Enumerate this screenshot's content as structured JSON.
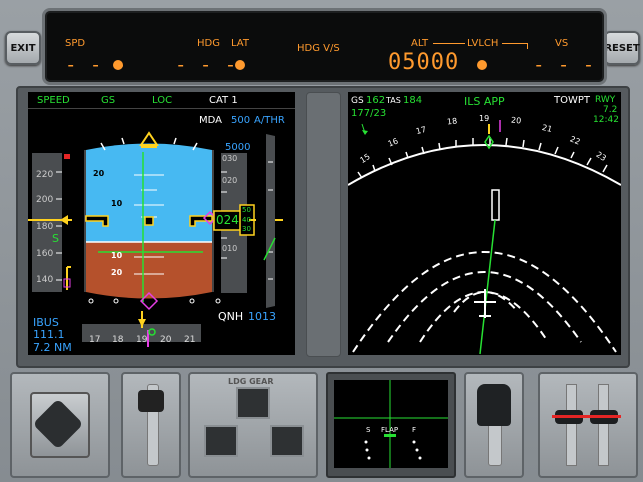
{
  "buttons": {
    "exit": "EXIT",
    "reset": "RESET"
  },
  "fcu": {
    "spd_label": "SPD",
    "spd_value": "- - -",
    "hdg_label": "HDG",
    "lat_label": "LAT",
    "hdg_value": "- - -",
    "mode_label": "HDG V/S",
    "alt_label": "ALT",
    "lvlch_label": "LVLCH",
    "alt_value": "05000",
    "vs_label": "VS",
    "vs_value": "- - -"
  },
  "pfd": {
    "fma": [
      "SPEED",
      "GS",
      "LOC",
      "CAT 1"
    ],
    "mda_label": "MDA",
    "mda_value": "500",
    "athr": "A/THR",
    "speed_ticks": [
      "220",
      "200",
      "180",
      "160",
      "140"
    ],
    "speed_marker": "S",
    "alt_ticks": [
      "030",
      "020",
      "010"
    ],
    "alt_target": "5000",
    "alt_current": "024",
    "alt_drum": [
      "50",
      "40",
      "30"
    ],
    "pitch_labels": [
      "20",
      "10",
      "10",
      "20"
    ],
    "qnh_label": "QNH",
    "qnh_value": "1013",
    "ils_ident": "IBUS",
    "ils_freq": "111.1",
    "ils_dist": "7.2  NM",
    "heading_ticks": [
      "17",
      "18",
      "19",
      "20",
      "21"
    ]
  },
  "nd": {
    "gs_label": "GS",
    "gs_value": "162",
    "tas_label": "TAS",
    "tas_value": "184",
    "mode": "ILS APP",
    "wind": "177/23",
    "wpt": "TOWPT",
    "rwy_label": "RWY",
    "rwy_dist": "7.2",
    "eta": "12:42",
    "compass": [
      "15",
      "16",
      "17",
      "18",
      "19",
      "20",
      "21",
      "22",
      "23"
    ]
  },
  "lower": {
    "ldg_gear": "LDG GEAR",
    "flap_label": "FLAP",
    "flap_s": "S",
    "flap_f": "F"
  },
  "colors": {
    "amber": "#ff9a2e",
    "green": "#27e033",
    "cyan": "#39a4ff",
    "magenta": "#e53ee5",
    "sky": "#47b9f2",
    "ground": "#b5512c"
  }
}
